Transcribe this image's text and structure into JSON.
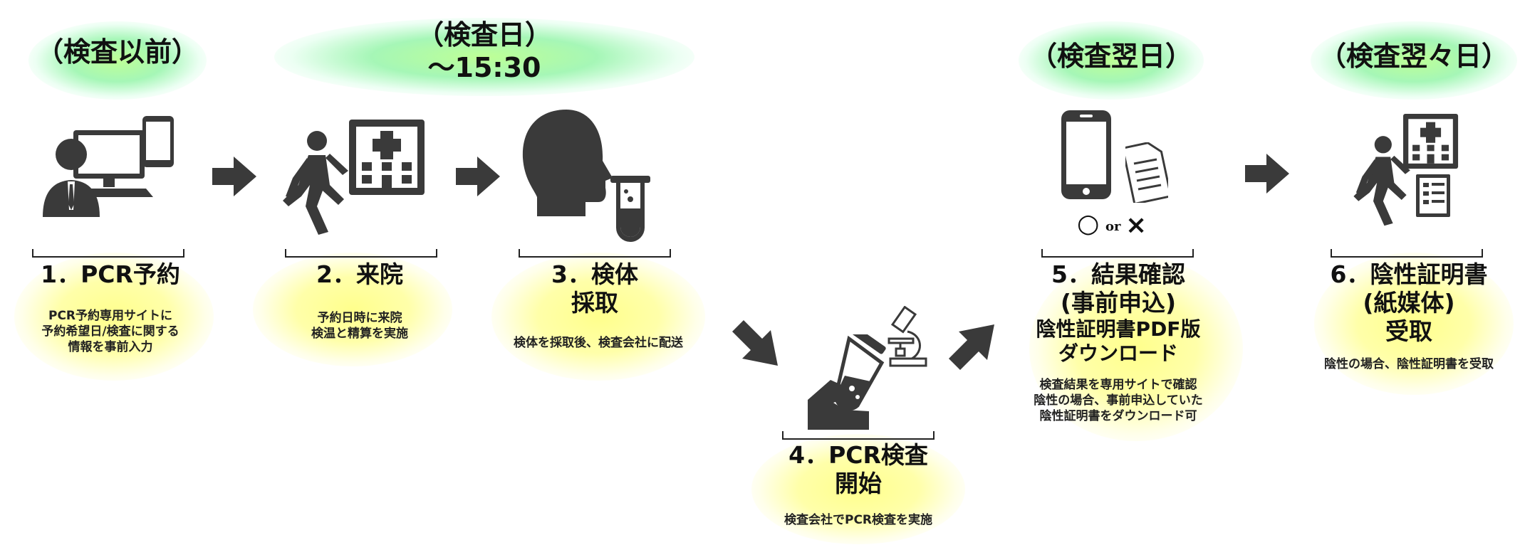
{
  "phases": {
    "before": "（検査以前）",
    "day_line1": "（検査日）",
    "day_line2": "～15:30",
    "next_day": "（検査翌日）",
    "day_after_next": "（検査翌々日）"
  },
  "steps": [
    {
      "title": [
        "1．PCR予約"
      ],
      "desc": [
        "PCR予約専用サイトに",
        "予約希望日/検査に関する",
        "情報を事前入力"
      ]
    },
    {
      "title": [
        "2．来院"
      ],
      "desc": [
        "予約日時に来院",
        "検温と精算を実施"
      ]
    },
    {
      "title": [
        "3．検体",
        "採取"
      ],
      "desc": [
        "検体を採取後、検査会社に配送"
      ]
    },
    {
      "title": [
        "4．PCR検査",
        "開始"
      ],
      "desc": [
        "検査会社でPCR検査を実施"
      ]
    },
    {
      "title": [
        "5．結果確認",
        "(事前申込)",
        "陰性証明書PDF版",
        "ダウンロード"
      ],
      "desc": [
        "検査結果を専用サイトで確認",
        "陰性の場合、事前申込していた",
        "陰性証明書をダウンロード可"
      ]
    },
    {
      "title": [
        "6．陰性証明書",
        "(紙媒体)",
        "受取"
      ],
      "desc": [
        "陰性の場合、陰性証明書を受取"
      ]
    }
  ],
  "result_symbols": {
    "circle": "○",
    "or": "or",
    "cross": "×"
  },
  "icons": [
    "computer-user-icon",
    "walking-person-icon",
    "hospital-icon",
    "head-profile-icon",
    "test-tube-icon",
    "microscope-icon",
    "hand-test-tube-icon",
    "smartphone-icon",
    "document-icon",
    "certificate-icon",
    "arrow-right-icon",
    "arrow-down-right-icon",
    "arrow-up-right-icon"
  ],
  "colors": {
    "icon": "#3a3a3a",
    "glow_green": "#aef5a8",
    "glow_yellow": "#ffff9a"
  }
}
